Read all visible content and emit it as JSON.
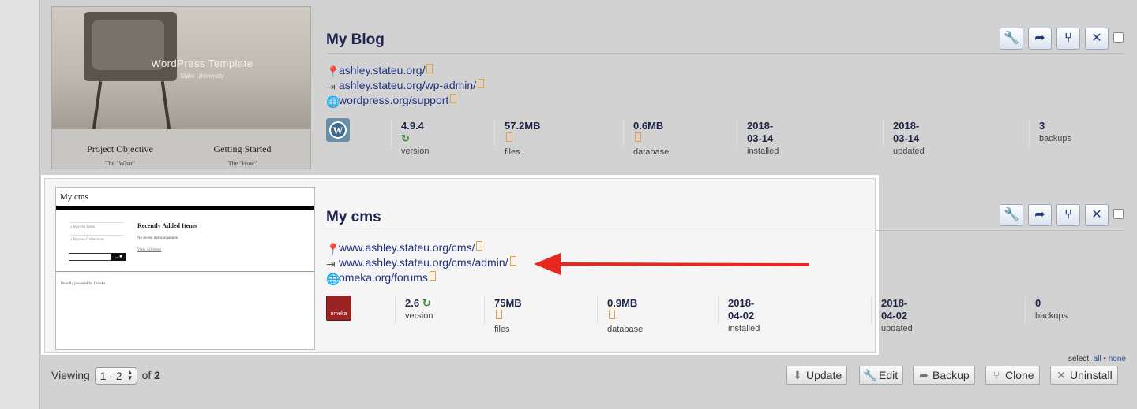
{
  "sites": [
    {
      "title": "My Blog",
      "urls": [
        "ashley.stateu.org/",
        "ashley.stateu.org/wp-admin/",
        "wordpress.org/support"
      ],
      "stats": [
        {
          "value": "4.9.4",
          "label": "version"
        },
        {
          "value": "57.2MB",
          "label": "files"
        },
        {
          "value": "0.6MB",
          "label": "database"
        },
        {
          "value": "2018-03-14",
          "label": "installed"
        },
        {
          "value": "2018-03-14",
          "label": "updated"
        },
        {
          "value": "3",
          "label": "backups"
        }
      ],
      "thumbnail": {
        "title": "WordPress Template",
        "subtitle": "State University",
        "col1_title": "Project Objective",
        "col1_sub": "The \"What\"",
        "col2_title": "Getting Started",
        "col2_sub": "The \"How\""
      },
      "icon": "wordpress-logo"
    },
    {
      "title": "My cms",
      "urls": [
        "www.ashley.stateu.org/cms/",
        "www.ashley.stateu.org/cms/admin/",
        "omeka.org/forums"
      ],
      "stats": [
        {
          "value": "2.6",
          "label": "version"
        },
        {
          "value": "75MB",
          "label": "files"
        },
        {
          "value": "0.9MB",
          "label": "database"
        },
        {
          "value": "2018-04-02",
          "label": "installed"
        },
        {
          "value": "2018-04-02",
          "label": "updated"
        },
        {
          "value": "0",
          "label": "backups"
        }
      ],
      "thumbnail": {
        "header": "My cms",
        "nav1": "» Browse Items",
        "nav2": "» Browse Collections",
        "recent_title": "Recently Added Items",
        "recent_empty": "No recent items available.",
        "view_all": "View All Items",
        "footer": "Proudly powered by Omeka."
      },
      "icon": "omeka-logo",
      "logo_text": "omeka"
    }
  ],
  "icons": {
    "location": "location-pin-icon",
    "login": "login-icon",
    "globe": "globe-icon",
    "refresh": "refresh-icon",
    "external": "external-link-icon",
    "wrench": "wrench-icon",
    "share": "share-icon",
    "clone": "clone-icon",
    "close": "close-icon"
  },
  "footer": {
    "viewing_prefix": "Viewing",
    "range": "1 - 2",
    "of": "of",
    "total": "2",
    "select_prefix": "select:",
    "select_all": "all",
    "select_sep": "•",
    "select_none": "none",
    "buttons": [
      "Update",
      "Edit",
      "Backup",
      "Clone",
      "Uninstall"
    ]
  },
  "colors": {
    "title": "#21244f",
    "link": "#21337e",
    "accent_arrow": "#e8281e",
    "refresh": "#3b8a3b"
  }
}
